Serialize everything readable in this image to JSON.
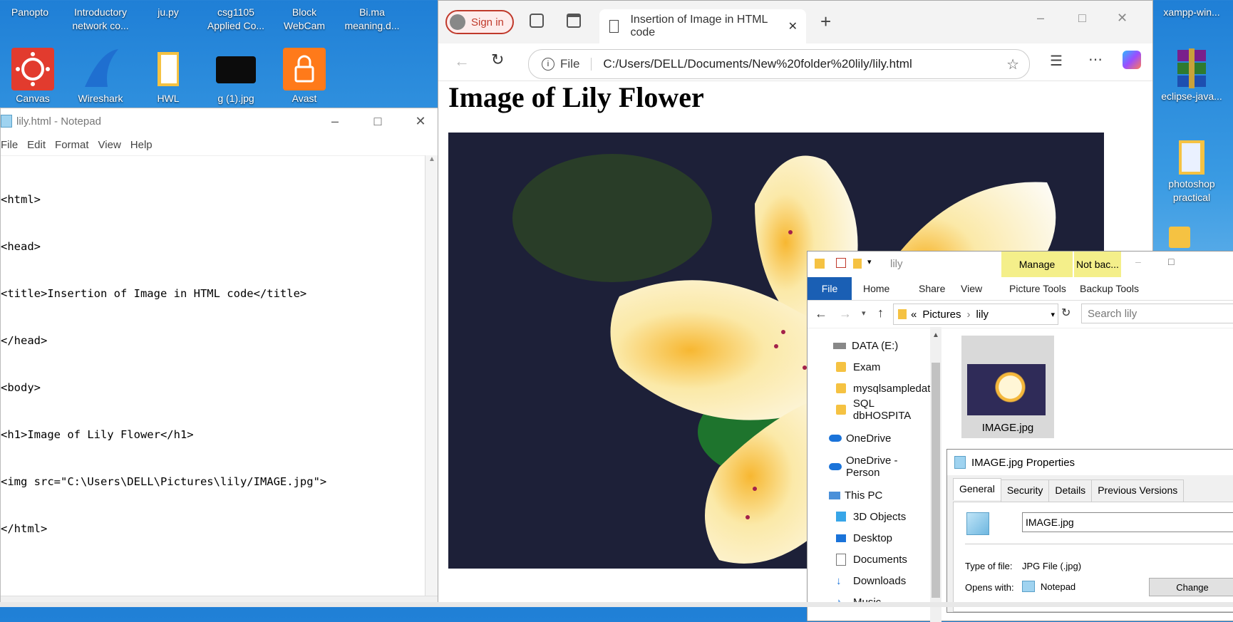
{
  "desktop": {
    "top_icons": [
      {
        "label_line1": "Panopto",
        "label_line2": ""
      },
      {
        "label_line1": "Introductory",
        "label_line2": "network co..."
      },
      {
        "label_line1": "ju.py",
        "label_line2": ""
      },
      {
        "label_line1": "csg1105",
        "label_line2": "Applied Co..."
      },
      {
        "label_line1": "Block",
        "label_line2": "WebCam"
      },
      {
        "label_line1": "Bi.ma",
        "label_line2": "meaning.d..."
      }
    ],
    "second_row_icons": [
      "Canvas",
      "Wireshark",
      "HWL",
      "g (1).jpg",
      "Avast"
    ],
    "right_icons": [
      {
        "label_line1": "xampp-win...",
        "label_line2": ""
      },
      {
        "label_line1": "eclipse-java...",
        "label_line2": ""
      },
      {
        "label_line1": "photoshop",
        "label_line2": "practical"
      }
    ]
  },
  "notepad": {
    "title": "lily.html - Notepad",
    "menu": [
      "File",
      "Edit",
      "Format",
      "View",
      "Help"
    ],
    "code_lines": [
      "<html>",
      "<head>",
      "<title>Insertion of Image in HTML code</title>",
      "</head>",
      "<body>",
      "<h1>Image of Lily Flower</h1>",
      "<img src=\"C:\\Users\\DELL\\Pictures\\lily/IMAGE.jpg\">",
      "</html>"
    ]
  },
  "browser": {
    "sign_in": "Sign in",
    "tab_title": "Insertion of Image in HTML code",
    "url_scheme": "File",
    "url": "C:/Users/DELL/Documents/New%20folder%20lily/lily.html",
    "page_heading": "Image of Lily Flower"
  },
  "explorer": {
    "title": "lily",
    "context_tabs": [
      "Manage",
      "Not bac..."
    ],
    "ribbon_tabs": [
      "File",
      "Home",
      "Share",
      "View",
      "Picture Tools",
      "Backup Tools"
    ],
    "breadcrumb": [
      "Pictures",
      "lily"
    ],
    "search_placeholder": "Search lily",
    "nav_items": [
      {
        "label": "DATA (E:)",
        "icon": "drive-icon"
      },
      {
        "label": "Exam",
        "icon": "folder-icon"
      },
      {
        "label": "mysqlsampledat",
        "icon": "folder-icon"
      },
      {
        "label": "SQL dbHOSPITA",
        "icon": "folder-icon"
      },
      {
        "label": "OneDrive",
        "icon": "cloud-icon"
      },
      {
        "label": "OneDrive - Person",
        "icon": "cloud-icon"
      },
      {
        "label": "This PC",
        "icon": "pc-icon"
      },
      {
        "label": "3D Objects",
        "icon": "cube-icon"
      },
      {
        "label": "Desktop",
        "icon": "desktop-icon"
      },
      {
        "label": "Documents",
        "icon": "documents-icon"
      },
      {
        "label": "Downloads",
        "icon": "downloads-icon"
      },
      {
        "label": "Music",
        "icon": "music-icon"
      }
    ],
    "file_name": "IMAGE.jpg"
  },
  "properties": {
    "title": "IMAGE.jpg Properties",
    "tabs": [
      "General",
      "Security",
      "Details",
      "Previous Versions"
    ],
    "file_name_value": "IMAGE.jpg",
    "type_label": "Type of file:",
    "type_value": "JPG File (.jpg)",
    "opens_label": "Opens with:",
    "opens_value": "Notepad",
    "change_button": "Change"
  }
}
